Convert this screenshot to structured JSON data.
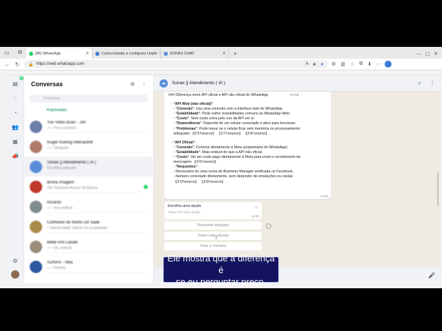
{
  "browser": {
    "tabs": [
      {
        "label": "(86) WhatsApp",
        "active": true,
        "color": "#25d366"
      },
      {
        "label": "Como instalar e configurar Unplé",
        "active": false,
        "color": "#3a7bd5"
      },
      {
        "label": "SONAX CHAT",
        "active": false,
        "color": "#5a8fd8"
      }
    ],
    "new_tab": "+",
    "url": "https://web.whatsapp.com"
  },
  "whatsapp": {
    "rail_badge": "86",
    "sidebar_title": "Conversas",
    "search_placeholder": "Pesquisar",
    "archived_label": "Arquivadas",
    "chats": [
      {
        "name": "Yuri Villas Boas - Jim",
        "sub": "✓✓ Ficou certinho!",
        "color": "#6b7fa8"
      },
      {
        "name": "Roger Koenig Hellvarelfit",
        "sub": "✓✓ Obrigado!",
        "color": "#b07a6a"
      },
      {
        "name": "Sonax || Atendimento ( IA )",
        "sub": "Em ótima pergunta",
        "color": "#5a8fd8",
        "selected": true
      },
      {
        "name": "Bruna Imagem",
        "sub": "TM: Pendente Nucleo 78:48 Envi",
        "color": "#c0392b",
        "unread": true
      },
      {
        "name": "Ricardo",
        "sub": "✓✓ Vou verificar",
        "color": "#7f8c8d"
      },
      {
        "name": "Conhecer do Ninho Gil Sade",
        "sub": "~ Vinicius Adali: Vamos ver a variedade",
        "color": "#a88a4a"
      },
      {
        "name": "Bebe Irmi Lavalli",
        "sub": "✓✓ Ok, entendi",
        "color": "#9b8b7a"
      },
      {
        "name": "SONAX - Mila",
        "sub": "✓✓ Perfeito",
        "color": "#2c5aa0"
      }
    ],
    "header_title": "Sonax || Atendimento ( IA )",
    "message": {
      "top_line": "### Diferença entre API oficial e API não oficial do WhatsApp",
      "fiove": "FIOVE",
      "api_web_title": "API Web (não oficial)",
      "api_web_colon": ":",
      "web_lines": [
        {
          "label": "Conexão",
          "text": ": Usa uma conexão com a interface web do WhatsApp."
        },
        {
          "label": "Estabilidade",
          "text": ": Pode sofrer instabilidades comuns ao WhatsApp Web."
        },
        {
          "label": "Custo",
          "text": ": Sem custo extra pelo uso da API em si."
        },
        {
          "label": "Dependência",
          "text": ": Depende de um celular conectado e ativo para funcionar."
        },
        {
          "label": "Problemas",
          "text": ": Pode travar se o celular ficar sem memória ou processamento"
        }
      ],
      "web_sources": "adequado.【0:6†source】 【3:7†source】 【3:9†source】.",
      "api_oficial_title": "API Oficial",
      "api_oficial_colon": ":",
      "oficial_lines": [
        {
          "label": "Conexão",
          "text": ": Conecta diretamente à Meta (proprietária do WhatsApp)."
        },
        {
          "label": "Estabilidade",
          "text": ": Mais estável do que a API não oficial."
        },
        {
          "label": "Custo",
          "text": ": Há um custo pago diretamente à Meta para envio e recebimento de"
        }
      ],
      "oficial_sources": "mensagem 【3:0†source】.",
      "req_label": "Requisitos",
      "req_colon": ":",
      "req_lines": [
        "- Necessário ter uma conta de Business Manager verificada no Facebook.",
        "- Número conectado diretamente, sem depender de emulações ou celular"
      ],
      "req_sources": "【3:0†source】 【3:8†source】.",
      "time": "12:40"
    },
    "choose": {
      "title": "Escolha uma opção",
      "subtitle": "Clique em uma opção",
      "time": "12:40"
    },
    "options": [
      "Resolvido obrigado",
      "Tenho outra dúvida",
      "Falar c/ humano"
    ]
  },
  "caption": {
    "line1": "Ele mostra que a diferença é",
    "line2": "se eu perguntar preço,"
  }
}
